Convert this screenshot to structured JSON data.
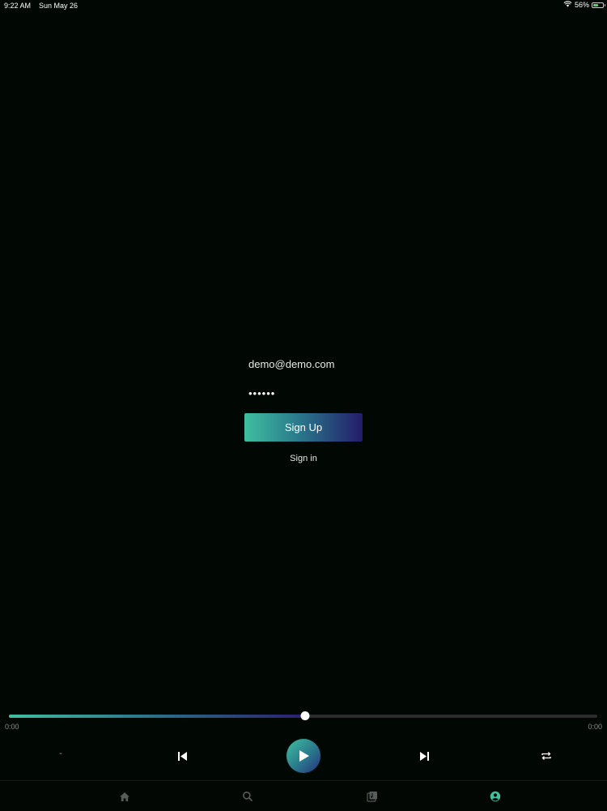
{
  "status_bar": {
    "time": "9:22 AM",
    "date": "Sun May 26",
    "battery_percent": "56%",
    "battery_level": 0.56,
    "icons": [
      "wifi-icon",
      "battery-icon"
    ]
  },
  "login": {
    "email_value": "demo@demo.com",
    "password_value": "••••••",
    "signup_label": "Sign Up",
    "signin_label": "Sign in"
  },
  "player": {
    "progress": 0.503,
    "current_time": "0:00",
    "total_time": "0:00",
    "track_title": "-",
    "icons": [
      "skip-previous-icon",
      "play-icon",
      "skip-next-icon",
      "repeat-icon"
    ]
  },
  "tab_bar": {
    "tabs": [
      {
        "name": "home",
        "icon": "home-icon",
        "active": false
      },
      {
        "name": "search",
        "icon": "search-icon",
        "active": false
      },
      {
        "name": "library",
        "icon": "library-icon",
        "active": false
      },
      {
        "name": "profile",
        "icon": "profile-icon",
        "active": true
      }
    ]
  },
  "colors": {
    "background": "#010803",
    "accent": "#3fbfa0",
    "accent_dark": "#241c6a",
    "inactive_icon": "#5a5a5a"
  }
}
